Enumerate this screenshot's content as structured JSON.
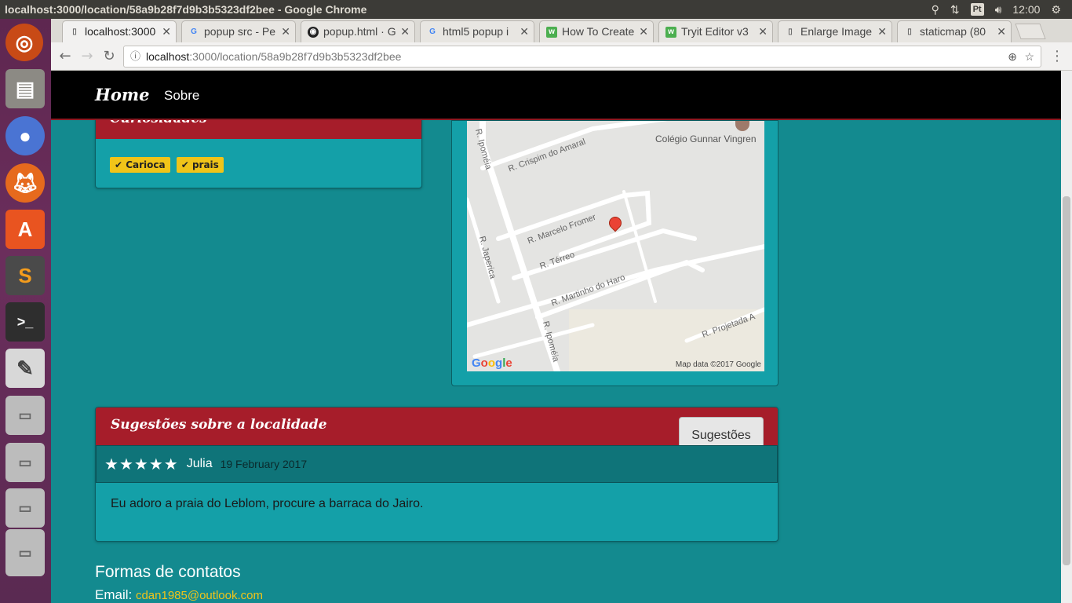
{
  "window": {
    "title": "localhost:3000/location/58a9b28f7d9b3b5323df2bee - Google Chrome"
  },
  "tray": {
    "language": "Pt",
    "time": "12:00"
  },
  "tabs": [
    {
      "label": "localhost:3000",
      "icon": "page-icon"
    },
    {
      "label": "popup src - Pe",
      "icon": "google-icon"
    },
    {
      "label": "popup.html · G",
      "icon": "github-icon"
    },
    {
      "label": "html5 popup i",
      "icon": "google-icon"
    },
    {
      "label": "How To Create",
      "icon": "w3-icon"
    },
    {
      "label": "Tryit Editor v3",
      "icon": "w3-icon"
    },
    {
      "label": "Enlarge Image",
      "icon": "page-icon"
    },
    {
      "label": "staticmap (80",
      "icon": "page-icon"
    }
  ],
  "omnibox": {
    "host": "localhost",
    "path": ":3000/location/58a9b28f7d9b3b5323df2bee"
  },
  "navbar": {
    "brand": "Home",
    "link": "Sobre"
  },
  "curiosidades": {
    "title": "Curiosidades",
    "tags": [
      "Carioca",
      "prais"
    ]
  },
  "map": {
    "poi": "Colégio Gunnar Vingren",
    "streets": [
      "R. Crispim do Amaral",
      "R. Ipoméia",
      "R. Marcelo Fromer",
      "R. Japerica",
      "R. Térreo",
      "R. Martinho do Haro",
      "R. Ipoméia",
      "R. Projetada A"
    ],
    "google": "Google",
    "attribution": "Map data ©2017 Google"
  },
  "sugestoes": {
    "title": "Sugestões sobre a localidade",
    "button": "Sugestões",
    "review": {
      "rating": 5,
      "author": "Julia",
      "date": "19 February 2017",
      "text": "Eu adoro a praia do Leblom, procure a barraca do Jairo."
    }
  },
  "contacts": {
    "title": "Formas de contatos",
    "email_label": "Email:",
    "email": "cdan1985@outlook.com"
  }
}
